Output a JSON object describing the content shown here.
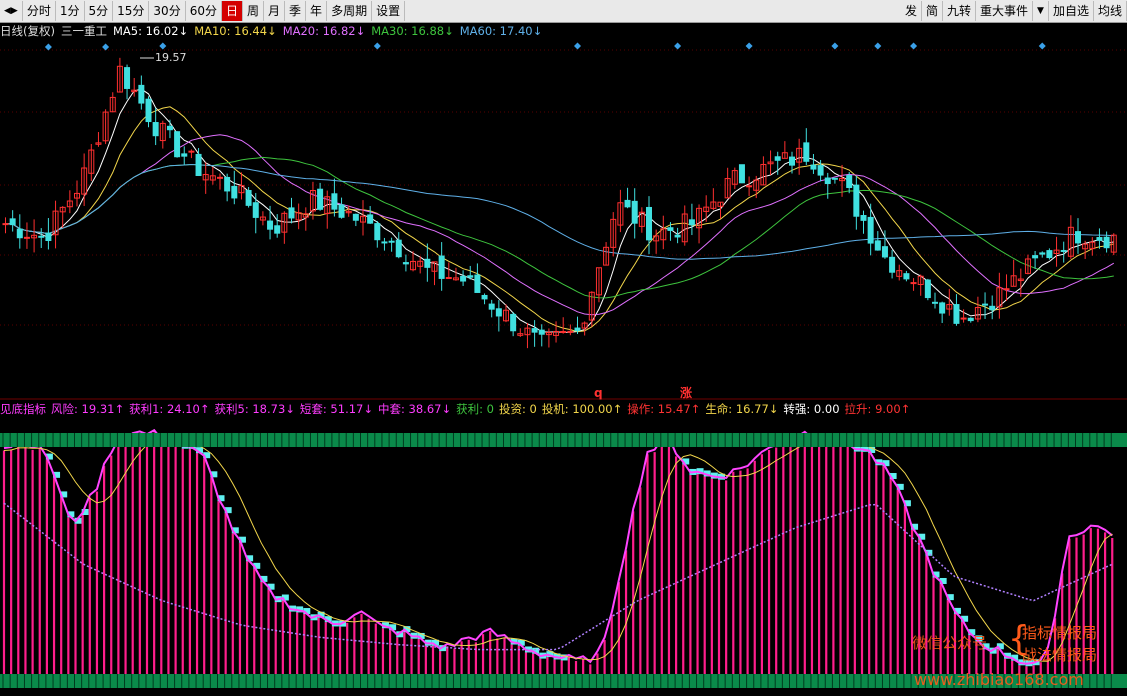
{
  "toolbar": {
    "left": [
      "分时",
      "1分",
      "5分",
      "15分",
      "30分",
      "60分",
      "日",
      "周",
      "月",
      "季",
      "年",
      "多周期",
      "设置"
    ],
    "active_index": 6,
    "right": [
      "发",
      "简",
      "九转",
      "重大事件",
      "加自选",
      "均线"
    ]
  },
  "ma_legend": {
    "title": "日线(复权)",
    "stock": "三一重工",
    "items": [
      {
        "label": "MA5: 16.02↓",
        "color": "#ffffff"
      },
      {
        "label": "MA10: 16.44↓",
        "color": "#f2d64b"
      },
      {
        "label": "MA20: 16.82↓",
        "color": "#e070ff"
      },
      {
        "label": "MA30: 16.88↓",
        "color": "#3ec43e"
      },
      {
        "label": "MA60: 17.40↓",
        "color": "#5fb0e8"
      }
    ]
  },
  "indicator_legend": {
    "title": "见底指标",
    "items": [
      {
        "label": "风险: 19.31↑",
        "color": "#ff3cff"
      },
      {
        "label": "获利1: 24.10↑",
        "color": "#ff3cff"
      },
      {
        "label": "获利5: 18.73↓",
        "color": "#ff3cff"
      },
      {
        "label": "短套: 51.17↓",
        "color": "#ff3cff"
      },
      {
        "label": "中套: 38.67↓",
        "color": "#ff3cff"
      },
      {
        "label": "获利: 0",
        "color": "#3ec43e"
      },
      {
        "label": "投资: 0",
        "color": "#f2d64b"
      },
      {
        "label": "投机: 100.00↑",
        "color": "#f2d64b"
      },
      {
        "label": "操作: 15.47↑",
        "color": "#ff3333"
      },
      {
        "label": "生命: 16.77↓",
        "color": "#f2d64b"
      },
      {
        "label": "转强: 0.00",
        "color": "#ffffff"
      },
      {
        "label": "拉升: 9.00↑",
        "color": "#ff3333"
      }
    ]
  },
  "markers": {
    "q": "q",
    "zhang": "涨"
  },
  "watermark": {
    "left": "微信公众号",
    "right1": "指标情报局",
    "right2": "战法情报局",
    "url": "www.zhibiao168.com"
  },
  "colors": {
    "up": "#ff3030",
    "down": "#40e0e0",
    "ma5": "#ffffff",
    "ma10": "#f2d64b",
    "ma20": "#e070ff",
    "ma30": "#3ec43e",
    "ma60": "#5fb0e8",
    "hist": "#ff1e8c",
    "hist_down": "#5ff0f0",
    "green_band": "#0a8a4a",
    "diamond": "#3aa0e8"
  },
  "chart_data": [
    {
      "type": "candlestick",
      "title": "",
      "price_labels": [
        {
          "text": "19.57",
          "value": 19.57
        }
      ],
      "ylim": [
        12.8,
        20.2
      ],
      "key_closes": [
        16.3,
        16.0,
        17.2,
        19.57,
        18.3,
        17.5,
        17.0,
        16.2,
        16.8,
        16.5,
        16.0,
        15.3,
        15.1,
        14.4,
        13.7,
        14.0,
        16.7,
        16.1,
        16.3,
        17.2,
        17.5,
        17.8,
        17.0,
        15.6,
        15.0,
        14.3,
        14.8,
        15.5,
        16.1,
        16.0
      ],
      "ma_last": {
        "MA5": 16.02,
        "MA10": 16.44,
        "MA20": 16.82,
        "MA30": 16.88,
        "MA60": 17.4
      }
    },
    {
      "type": "bar",
      "title": "",
      "ylim": [
        0,
        100
      ],
      "profile": [
        92,
        95,
        88,
        60,
        72,
        95,
        98,
        97,
        93,
        88,
        65,
        45,
        32,
        27,
        22,
        20,
        25,
        18,
        16,
        12,
        10,
        14,
        16,
        12,
        8,
        6,
        4,
        8,
        50,
        90,
        95,
        82,
        80,
        82,
        88,
        95,
        98,
        96,
        94,
        90,
        80,
        60,
        40,
        22,
        12,
        8,
        4,
        3,
        55,
        60,
        57
      ]
    }
  ]
}
